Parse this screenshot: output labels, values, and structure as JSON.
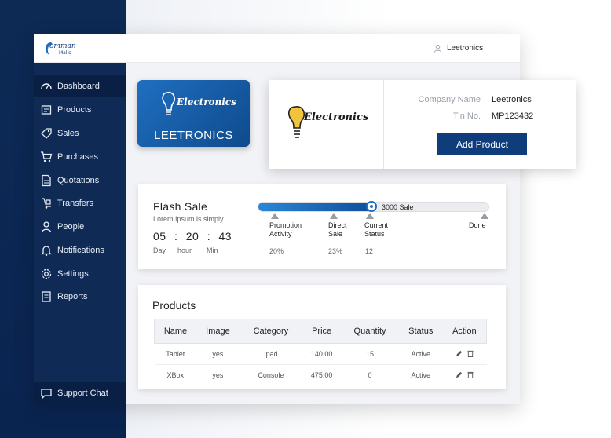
{
  "app": {
    "logo_text": "Comman Malls",
    "user_name": "Leetronics"
  },
  "sidebar": {
    "items": [
      {
        "label": "Dashboard",
        "icon": "dashboard-icon"
      },
      {
        "label": "Products",
        "icon": "products-icon"
      },
      {
        "label": "Sales",
        "icon": "sales-tag-icon"
      },
      {
        "label": "Purchases",
        "icon": "cart-icon"
      },
      {
        "label": "Quotations",
        "icon": "document-icon"
      },
      {
        "label": "Transfers",
        "icon": "dolly-icon"
      },
      {
        "label": "People",
        "icon": "person-icon"
      },
      {
        "label": "Notifications",
        "icon": "bell-icon"
      },
      {
        "label": "Settings",
        "icon": "gear-icon"
      },
      {
        "label": "Reports",
        "icon": "report-icon"
      }
    ],
    "support_label": "Support Chat"
  },
  "brand": {
    "script_text": "Electronics",
    "name": "LEETRONICS"
  },
  "company": {
    "name_label": "Company Name",
    "name_value": "Leetronics",
    "tin_label": "Tin No.",
    "tin_value": "MP123432",
    "add_button": "Add Product"
  },
  "flash_sale": {
    "title": "Flash  Sale",
    "subtitle": "Lorem Ipsum is simply",
    "timer": {
      "hours": "05",
      "minutes": "20",
      "seconds": "43",
      "sep": ":"
    },
    "timer_labels": {
      "day": "Day",
      "hour": "hour",
      "min": "Min"
    },
    "progress_fraction": 0.49,
    "progress_label": "3000 Sale",
    "stages": [
      {
        "label1": "Promotion",
        "label2": "Activity",
        "value": "20%"
      },
      {
        "label1": "Direct",
        "label2": "Sale",
        "value": "23%"
      },
      {
        "label1": "Current",
        "label2": "Status",
        "value": "12"
      },
      {
        "label1": "Done",
        "label2": "",
        "value": ""
      }
    ]
  },
  "products": {
    "title": "Products",
    "columns": [
      "Name",
      "Image",
      "Category",
      "Price",
      "Quantity",
      "Status",
      "Action"
    ],
    "rows": [
      {
        "name": "Tablet",
        "image": "yes",
        "category": "Ipad",
        "price": "140.00",
        "quantity": "15",
        "status": "Active"
      },
      {
        "name": "XBox",
        "image": "yes",
        "category": "Console",
        "price": "475.00",
        "quantity": "0",
        "status": "Active"
      }
    ]
  },
  "colors": {
    "sidebar": "#0e2a55",
    "accent": "#0f3c7a",
    "progress": "#1e6fc4"
  }
}
